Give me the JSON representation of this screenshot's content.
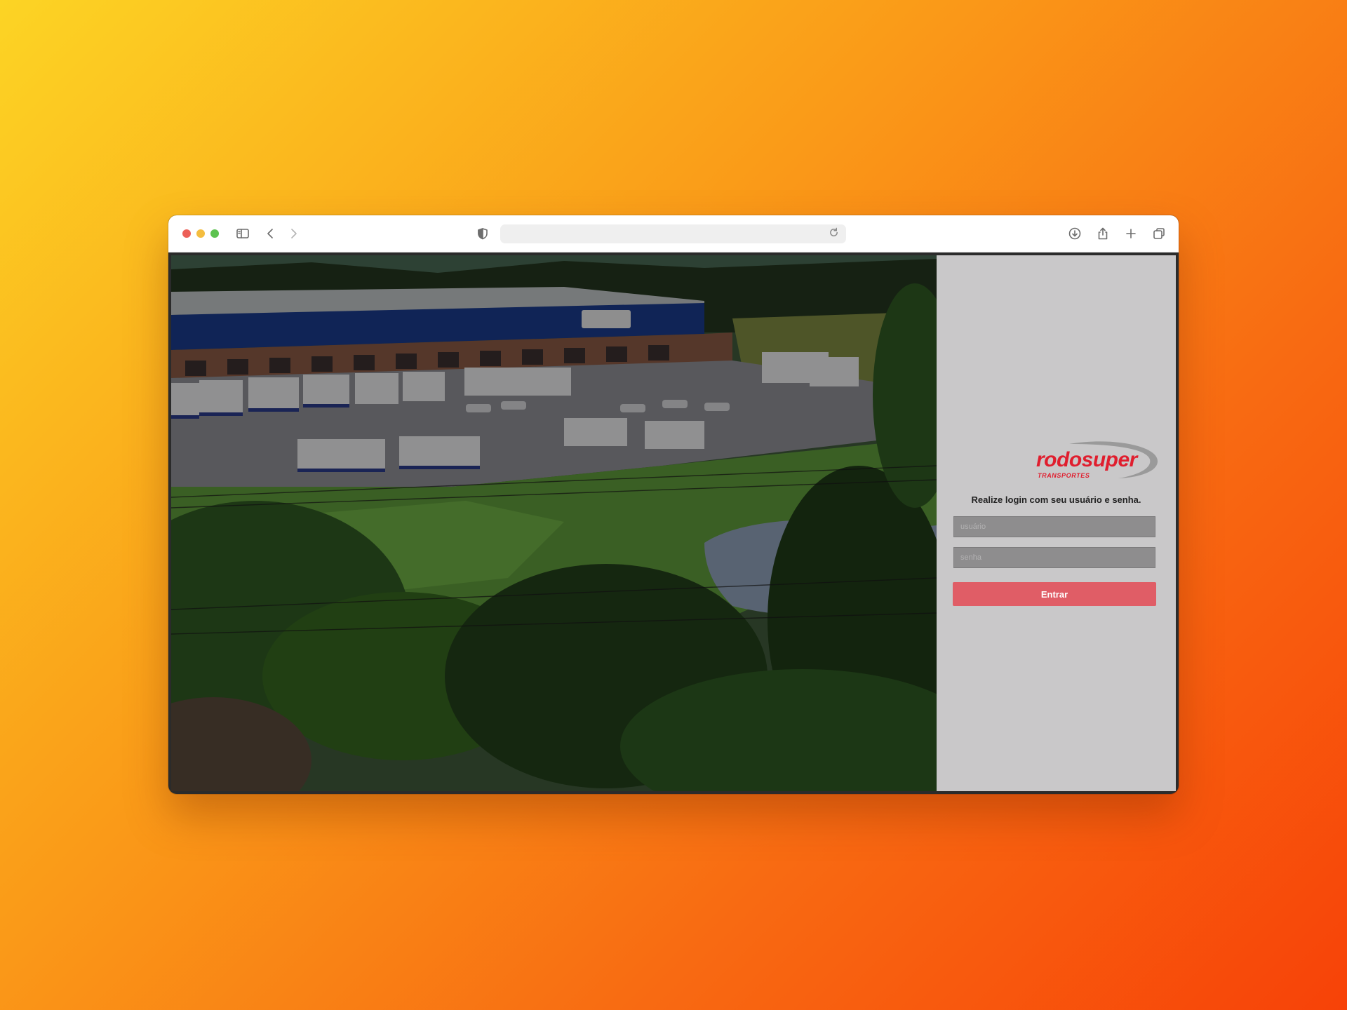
{
  "browser": {
    "url": "",
    "icons": {
      "sidebar": "sidebar-icon",
      "back": "chevron-left-icon",
      "forward": "chevron-right-icon",
      "privacy": "shield-icon",
      "reload": "reload-icon",
      "download": "download-icon",
      "share": "share-icon",
      "new_tab": "plus-icon",
      "tabs": "tabs-icon"
    }
  },
  "page": {
    "background_image": "aerial photo of truck depot with warehouse, trucks, trees and a pond",
    "logo": {
      "name": "rodosuper",
      "subtitle": "TRANSPORTES"
    },
    "login": {
      "instruction": "Realize login com seu usuário e senha.",
      "username_placeholder": "usuário",
      "password_placeholder": "senha",
      "submit_label": "Entrar"
    },
    "colors": {
      "accent": "#e05d66",
      "brand": "#e01e2e",
      "panel": "#c9c8c9"
    }
  }
}
